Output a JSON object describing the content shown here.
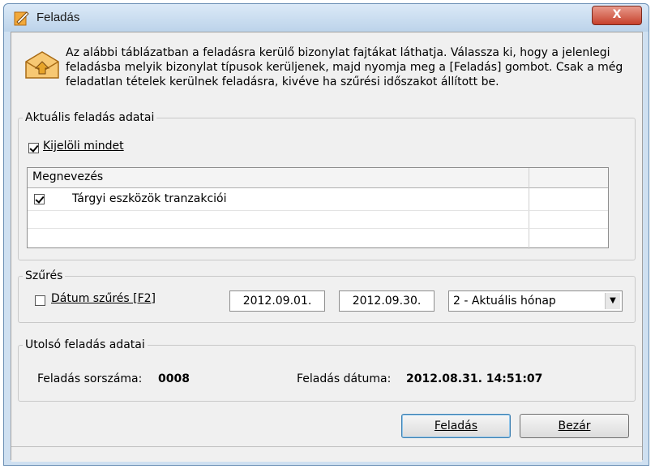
{
  "window": {
    "title": "Feladás",
    "close_label": "X"
  },
  "intro": {
    "text": "Az alábbi táblázatban a feladásra kerülő bizonylat fajtákat láthatja. Válassza ki, hogy a jelenlegi feladásba melyik bizonylat típusok kerüljenek, majd nyomja meg a [Feladás] gombot. Csak a még feladatlan tételek kerülnek feladásra, kivéve ha szűrési időszakot állított be."
  },
  "current": {
    "legend": "Aktuális feladás adatai",
    "select_all_label": "Kijelöli mindet",
    "select_all_checked": true,
    "grid": {
      "columns": [
        "Megnevezés",
        ""
      ],
      "rows": [
        {
          "checked": true,
          "name": "Tárgyi eszközök tranzakciói"
        }
      ]
    }
  },
  "filter": {
    "legend": "Szűrés",
    "date_filter_label": "Dátum szűrés [F2]",
    "date_filter_checked": false,
    "date_from": "2012.09.01.",
    "date_to": "2012.09.30.",
    "period_selected": "2 - Aktuális hónap"
  },
  "last": {
    "legend": "Utolsó feladás adatai",
    "number_label": "Feladás sorszáma:",
    "number_value": "0008",
    "date_label": "Feladás dátuma:",
    "date_value": "2012.08.31. 14:51:07"
  },
  "buttons": {
    "submit_label": "Feladás",
    "close_label": "Bezár"
  },
  "icons": {
    "app": "pen-document-icon",
    "intro": "envelope-arrow-icon",
    "dropdown": "chevron-down-icon"
  }
}
